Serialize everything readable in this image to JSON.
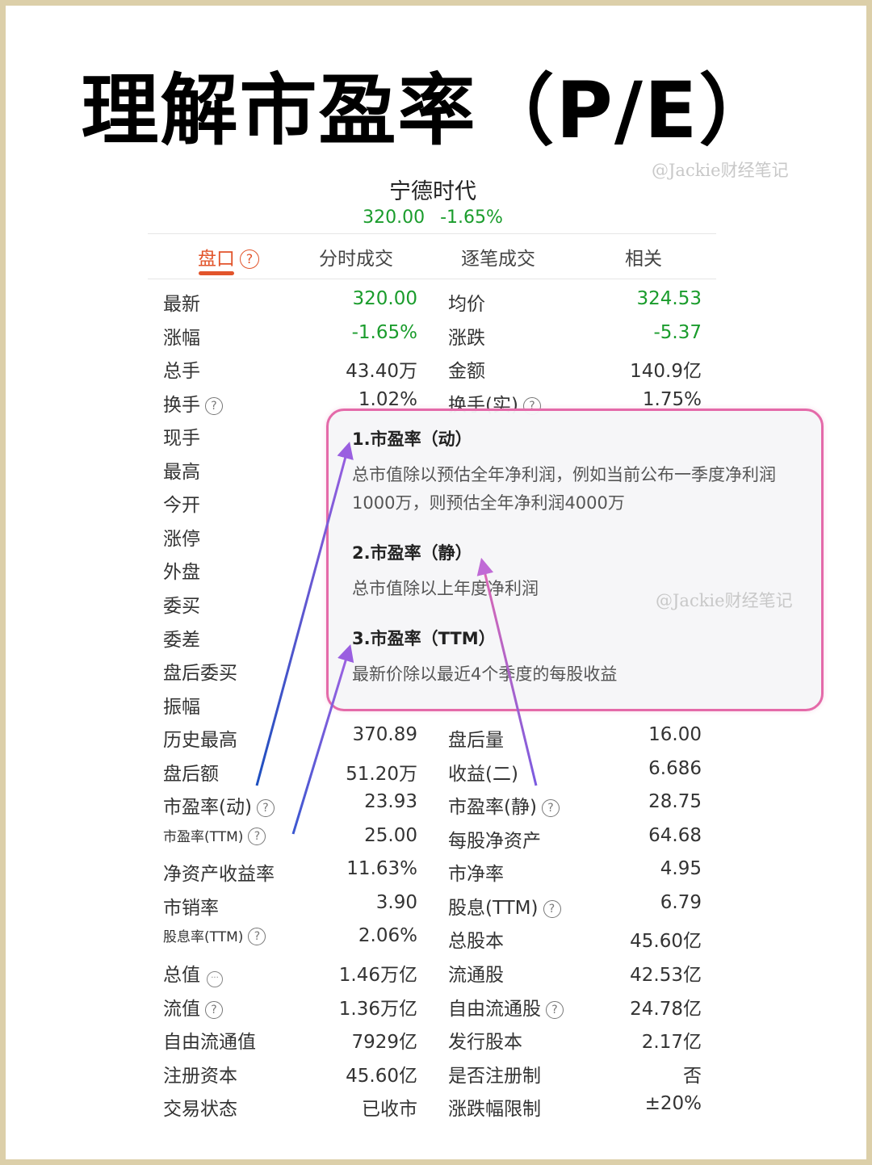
{
  "title": "理解市盈率（P/E）",
  "watermark": "@Jackie财经笔记",
  "stock": {
    "name": "宁德时代",
    "price": "320.00",
    "change_pct": "-1.65%"
  },
  "tabs": [
    {
      "label": "盘口"
    },
    {
      "label": "分时成交"
    },
    {
      "label": "逐笔成交"
    },
    {
      "label": "相关"
    }
  ],
  "icons": {
    "help": "question-circle-icon",
    "more": "ellipsis-circle-icon",
    "help_glyph": "?",
    "more_glyph": "···"
  },
  "colors": {
    "up_green": "#1a9c2c",
    "accent": "#e2542b",
    "popup_border": "#e46aa9",
    "arrow_blue": "#2255cc",
    "arrow_purple": "#9a5fe0",
    "arrow_pink": "#c86ad8"
  },
  "rows": [
    {
      "l1": "最新",
      "v1": "320.00",
      "l2": "均价",
      "v2": "324.53"
    },
    {
      "l1": "涨幅",
      "v1": "-1.65%",
      "l2": "涨跌",
      "v2": "-5.37"
    },
    {
      "l1": "总手",
      "v1": "43.40万",
      "l2": "金额",
      "v2": "140.9亿"
    },
    {
      "l1": "换手",
      "v1": "1.02%",
      "l2": "换手(实)",
      "v2": "1.75%"
    },
    {
      "l1": "现手",
      "v1": "",
      "l2": "",
      "v2": ""
    },
    {
      "l1": "最高",
      "v1": "",
      "l2": "",
      "v2": ""
    },
    {
      "l1": "今开",
      "v1": "",
      "l2": "",
      "v2": ""
    },
    {
      "l1": "涨停",
      "v1": "",
      "l2": "",
      "v2": ""
    },
    {
      "l1": "外盘",
      "v1": "",
      "l2": "",
      "v2": ""
    },
    {
      "l1": "委买",
      "v1": "",
      "l2": "",
      "v2": ""
    },
    {
      "l1": "委差",
      "v1": "",
      "l2": "",
      "v2": ""
    },
    {
      "l1": "盘后委买",
      "v1": "",
      "l2": "",
      "v2": ""
    },
    {
      "l1": "振幅",
      "v1": "",
      "l2": "",
      "v2": ""
    },
    {
      "l1": "历史最高",
      "v1": "370.89",
      "l2": "盘后量",
      "v2": "16.00"
    },
    {
      "l1": "盘后额",
      "v1": "51.20万",
      "l2": "收益(二)",
      "v2": "6.686"
    },
    {
      "l1": "市盈率(动)",
      "v1": "23.93",
      "l2": "市盈率(静)",
      "v2": "28.75"
    },
    {
      "l1": "市盈率(TTM)",
      "v1": "25.00",
      "l2": "每股净资产",
      "v2": "64.68"
    },
    {
      "l1": "净资产收益率",
      "v1": "11.63%",
      "l2": "市净率",
      "v2": "4.95"
    },
    {
      "l1": "市销率",
      "v1": "3.90",
      "l2": "股息(TTM)",
      "v2": "6.79"
    },
    {
      "l1": "股息率(TTM)",
      "v1": "2.06%",
      "l2": "总股本",
      "v2": "45.60亿"
    },
    {
      "l1": "总值",
      "v1": "1.46万亿",
      "l2": "流通股",
      "v2": "42.53亿"
    },
    {
      "l1": "流值",
      "v1": "1.36万亿",
      "l2": "自由流通股",
      "v2": "24.78亿"
    },
    {
      "l1": "自由流通值",
      "v1": "7929亿",
      "l2": "发行股本",
      "v2": "2.17亿"
    },
    {
      "l1": "注册资本",
      "v1": "45.60亿",
      "l2": "是否注册制",
      "v2": "否"
    },
    {
      "l1": "交易状态",
      "v1": "已收市",
      "l2": "涨跌幅限制",
      "v2": "±20%"
    }
  ],
  "popup": {
    "items": [
      {
        "title": "1.市盈率（动）",
        "desc": "总市值除以预估全年净利润，例如当前公布一季度净利润1000万，则预估全年净利润4000万"
      },
      {
        "title": "2.市盈率（静）",
        "desc": "总市值除以上年度净利润"
      },
      {
        "title": "3.市盈率（TTM）",
        "desc": "最新价除以最近4个季度的每股收益"
      }
    ]
  }
}
